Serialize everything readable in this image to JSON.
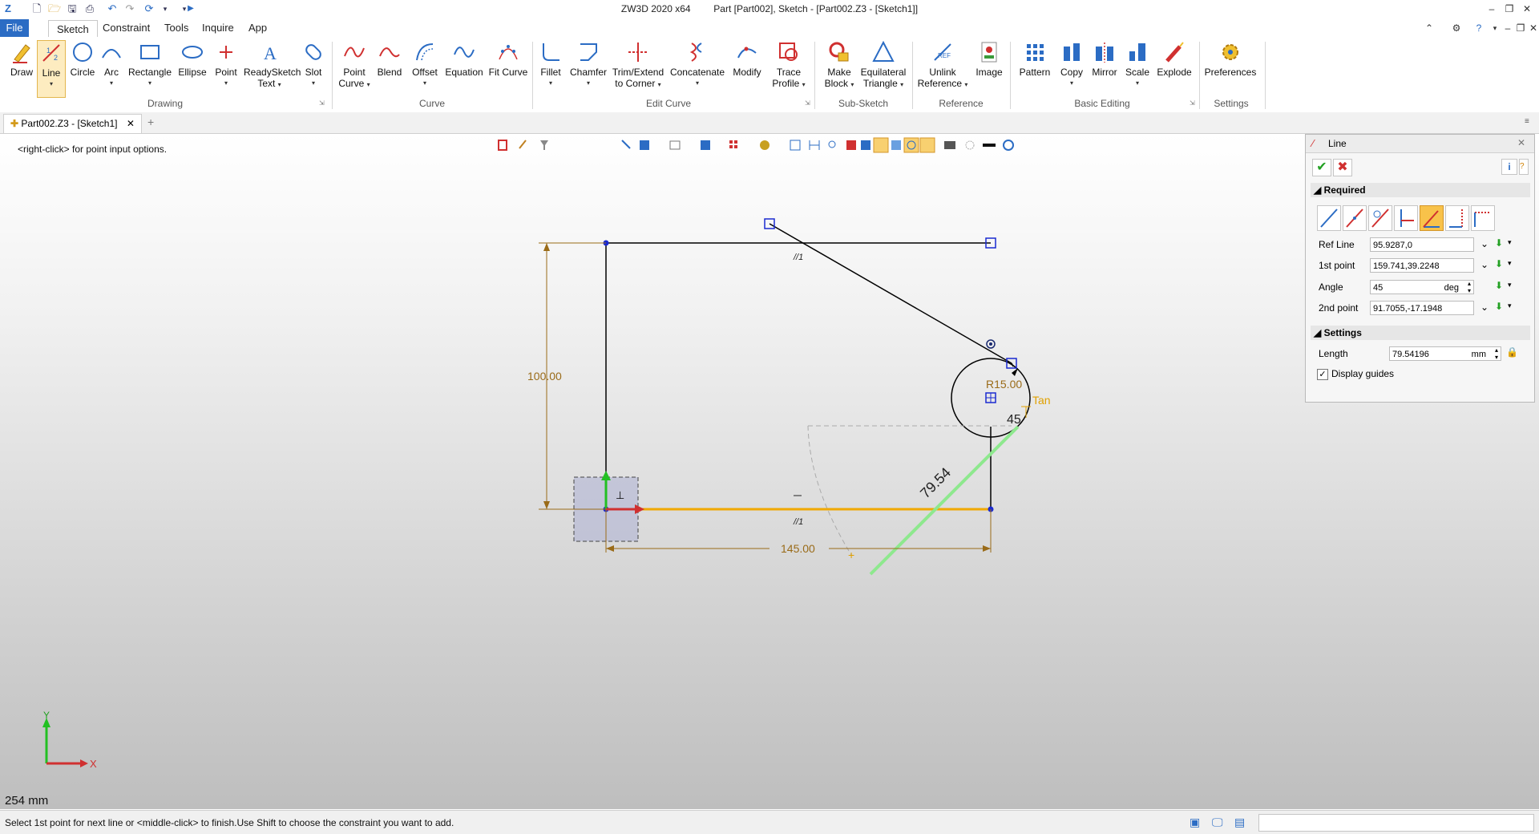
{
  "app": {
    "title": "ZW3D 2020 x64",
    "document": "Part [Part002],  Sketch - [Part002.Z3 - [Sketch1]]"
  },
  "menu": {
    "tabs": [
      "File",
      "Sketch",
      "Constraint",
      "Tools",
      "Inquire",
      "App"
    ],
    "active": "Sketch"
  },
  "ribbon": {
    "groups": {
      "drawing": "Drawing",
      "curve": "Curve",
      "edit_curve": "Edit Curve",
      "sub_sketch": "Sub-Sketch",
      "reference": "Reference",
      "basic_editing": "Basic Editing",
      "settings": "Settings"
    },
    "buttons": {
      "draw": "Draw",
      "line": "Line",
      "circle": "Circle",
      "arc": "Arc",
      "rectangle": "Rectangle",
      "ellipse": "Ellipse",
      "point": "Point",
      "readysketch_1": "ReadySketch",
      "readysketch_2": "Text",
      "slot": "Slot",
      "point_curve_1": "Point",
      "point_curve_2": "Curve",
      "blend": "Blend",
      "offset": "Offset",
      "equation": "Equation",
      "fit_curve": "Fit Curve",
      "fillet": "Fillet",
      "chamfer": "Chamfer",
      "trim_1": "Trim/Extend",
      "trim_2": "to Corner",
      "concatenate": "Concatenate",
      "modify": "Modify",
      "trace_1": "Trace",
      "trace_2": "Profile",
      "make_block_1": "Make",
      "make_block_2": "Block",
      "equilateral_1": "Equilateral",
      "equilateral_2": "Triangle",
      "unlink_1": "Unlink",
      "unlink_2": "Reference",
      "image": "Image",
      "pattern": "Pattern",
      "copy": "Copy",
      "mirror": "Mirror",
      "scale": "Scale",
      "explode": "Explode",
      "preferences": "Preferences"
    }
  },
  "doc_tab": "Part002.Z3 - [Sketch1]",
  "viewport": {
    "hint": "<right-click> for point input options.",
    "scale_readout": "254 mm",
    "dims": {
      "vertical": "100.00",
      "horizontal": "145.00",
      "radius": "R15.00",
      "length": "79.54",
      "angle": "45",
      "tan": "Tan",
      "parallel": "//1"
    },
    "axes": {
      "x": "X",
      "y": "Y"
    }
  },
  "panel": {
    "title": "Line",
    "required": "Required",
    "settings": "Settings",
    "fields": {
      "ref_line_label": "Ref Line",
      "ref_line_value": "95.9287,0",
      "first_point_label": "1st point",
      "first_point_value": "159.741,39.2248",
      "angle_label": "Angle",
      "angle_value": "45",
      "angle_unit": "deg",
      "second_point_label": "2nd point",
      "second_point_value": "91.7055,-17.1948",
      "length_label": "Length",
      "length_value": "79.54196",
      "length_unit": "mm",
      "display_guides": "Display guides"
    }
  },
  "status": {
    "message": "Select 1st point for next line or <middle-click> to finish.Use Shift to choose the constraint you want to add."
  },
  "colors": {
    "accent": "#2b6cc4",
    "construction": "#d4a017",
    "preview": "#8ee88e",
    "selected": "#f8c24a",
    "dim": "#9a6b18"
  }
}
